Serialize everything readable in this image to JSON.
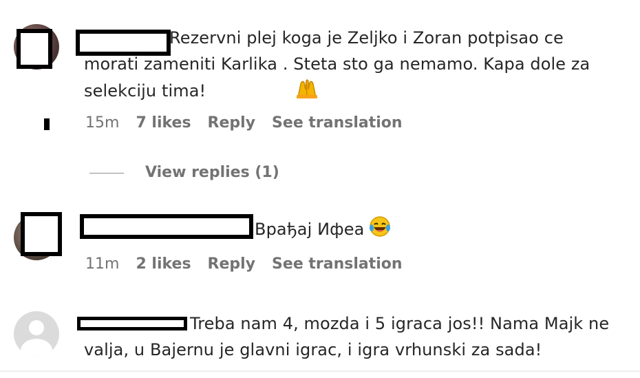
{
  "comments": [
    {
      "text": "Rezervni plej koga je Zeljko i Zoran potpisao ce morati zameniti Karlika . Steta sto ga nemamo. Kapa dole za selekciju tima!",
      "emoji": "praising-hands",
      "time": "15m",
      "likes": "7 likes",
      "reply": "Reply",
      "translate": "See translation"
    },
    {
      "text": "Врађај Ифеа",
      "emoji": "laughing-tears",
      "time": "11m",
      "likes": "2 likes",
      "reply": "Reply",
      "translate": "See translation"
    },
    {
      "text": "Treba nam 4, mozda i 5 igraca jos!! Nama Majk ne valja, u Bajernu je glavni igrac, i igra vrhunski za sada!"
    }
  ],
  "view_replies": "View replies (1)"
}
